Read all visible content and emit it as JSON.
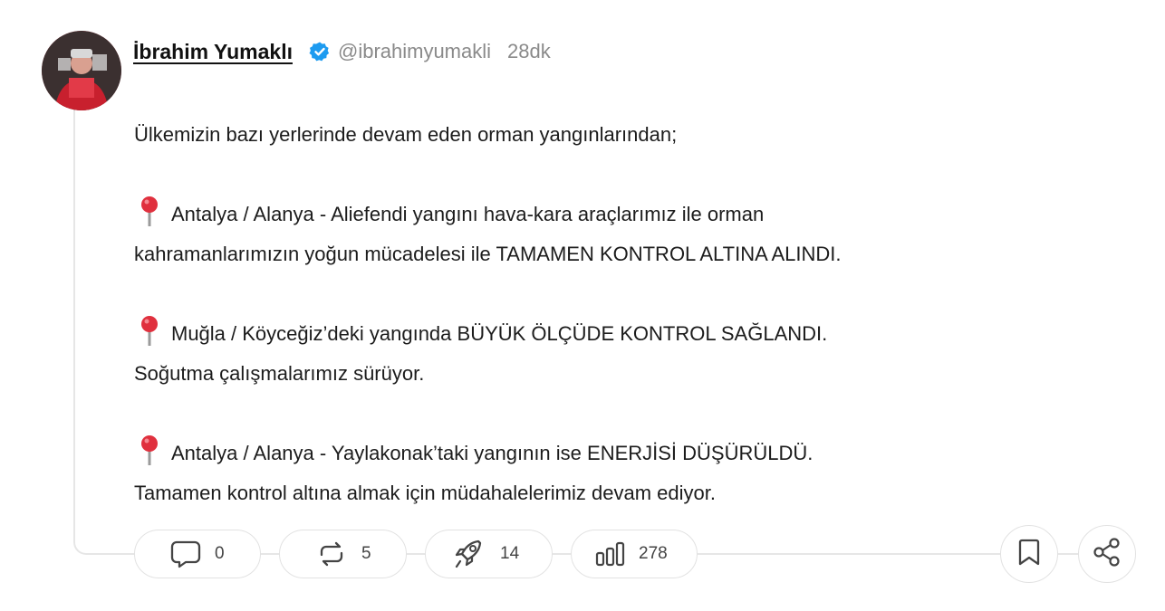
{
  "post": {
    "author": {
      "name": "İbrahim Yumaklı",
      "handle": "@ibrahimyumakli",
      "time": "28dk",
      "verified_color": "#1d9bf0",
      "avatar_accent": "#c8202e"
    },
    "paragraphs": [
      {
        "pin": false,
        "lines": [
          "Ülkemizin bazı yerlerinde devam eden orman yangınlarından;"
        ]
      },
      {
        "pin": true,
        "lines": [
          "Antalya / Alanya - Aliefendi yangını hava-kara araçlarımız ile orman",
          "kahramanlarımızın yoğun mücadelesi ile TAMAMEN KONTROL ALTINA ALINDI."
        ]
      },
      {
        "pin": true,
        "lines": [
          "Muğla / Köyceğiz’deki yangında BÜYÜK ÖLÇÜDE KONTROL SAĞLANDI.",
          "Soğutma çalışmalarımız sürüyor."
        ]
      },
      {
        "pin": true,
        "lines": [
          "Antalya / Alanya - Yaylakonak’taki yangının ise ENERJİSİ DÜŞÜRÜLDÜ.",
          "Tamamen kontrol altına almak için müdahalelerimiz devam ediyor."
        ]
      }
    ]
  },
  "actions": {
    "comments": {
      "icon": "comment-icon",
      "count": "0"
    },
    "reposts": {
      "icon": "repost-icon",
      "count": "5"
    },
    "boosts": {
      "icon": "rocket-icon",
      "count": "14"
    },
    "views": {
      "icon": "bar-chart-icon",
      "count": "278"
    },
    "bookmark": {
      "icon": "bookmark-icon"
    },
    "share": {
      "icon": "share-icon"
    }
  }
}
